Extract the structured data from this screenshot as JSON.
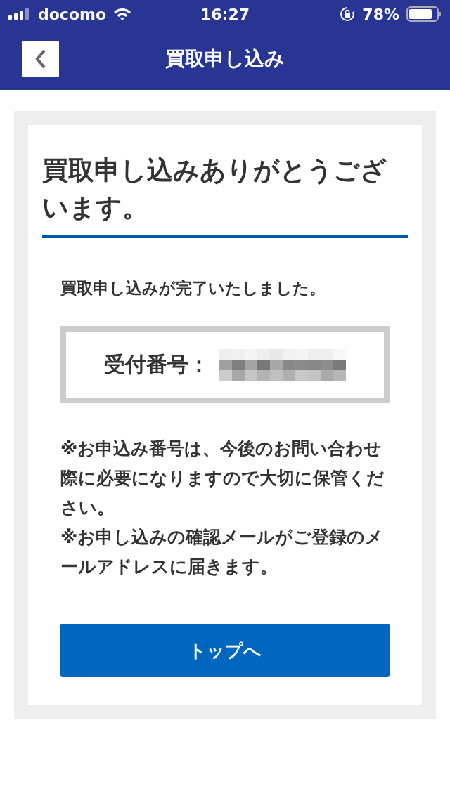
{
  "status_bar": {
    "carrier": "docomo",
    "time": "16:27",
    "battery": "78%"
  },
  "nav": {
    "title": "買取申し込み"
  },
  "heading": "買取申し込みありがとうございます。",
  "message": "買取申し込みが完了いたしました。",
  "receipt": {
    "label": "受付番号："
  },
  "notes": [
    "※お申込み番号は、今後のお問い合わせ際に必要になりますので大切に保管ください。",
    "※お申し込みの確認メールがご登録のメールアドレスに届きます。"
  ],
  "button": "トップへ"
}
